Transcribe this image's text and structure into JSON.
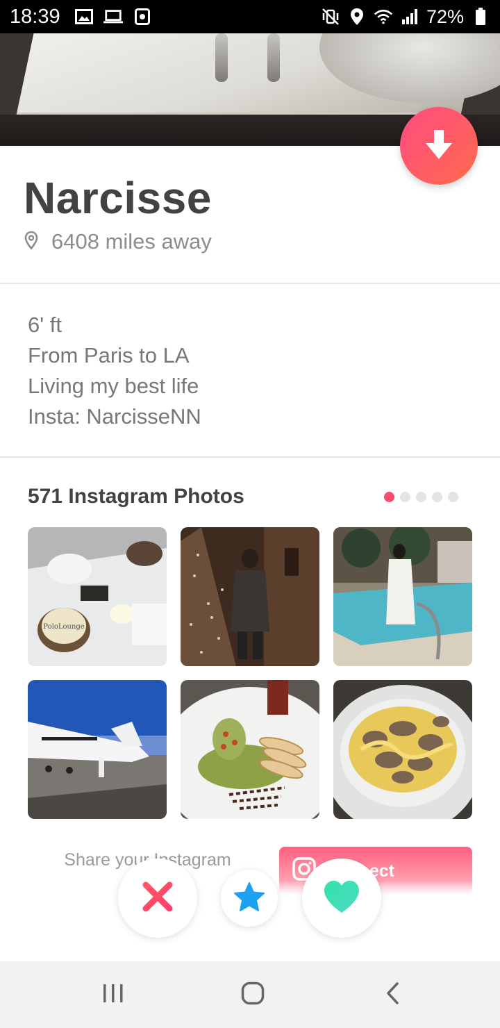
{
  "status_bar": {
    "time": "18:39",
    "battery_percent": "72%",
    "left_icons": [
      "image-icon",
      "laptop-icon",
      "clock-icon"
    ],
    "right_icons": [
      "mute-vibrate-icon",
      "location-icon",
      "wifi-icon",
      "signal-icon",
      "battery-icon"
    ]
  },
  "profile": {
    "name": "Narcisse",
    "distance": "6408 miles away",
    "bio_lines": [
      "6' ft",
      "From Paris to LA",
      "Living my best life",
      "Insta: NarcisseNN"
    ]
  },
  "instagram": {
    "title": "571 Instagram Photos",
    "pager": {
      "count": 5,
      "active_index": 0
    },
    "photos": [
      {
        "icon": "photo-dessert",
        "caption_text": "PoloLounge"
      },
      {
        "icon": "photo-christmas-tree"
      },
      {
        "icon": "photo-pool"
      },
      {
        "icon": "photo-private-jet"
      },
      {
        "icon": "photo-plated-dish"
      },
      {
        "icon": "photo-truffle-pasta"
      }
    ],
    "share_text": "Share your Instagram photos",
    "connect_label": "Connect"
  },
  "actions": {
    "nope_icon": "close-icon",
    "superlike_icon": "star-icon",
    "like_icon": "heart-icon"
  },
  "colors": {
    "brand_gradient_start": "#ff4b84",
    "brand_gradient_end": "#ff6b4a",
    "nope": "#fd5068",
    "superlike": "#1da1f2",
    "like": "#3fe1b0",
    "pager_active": "#fd4b6c"
  }
}
